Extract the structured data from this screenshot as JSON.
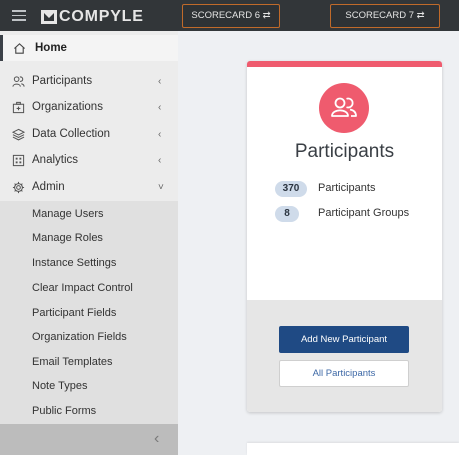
{
  "header": {
    "logo_text": "COMPYLE",
    "scorecard_buttons": [
      "SCORECARD 6 ⇄",
      "SCORECARD 7 ⇄"
    ]
  },
  "sidebar": {
    "items": [
      {
        "label": "Home",
        "icon": "home-icon"
      },
      {
        "label": "Participants",
        "icon": "participants-icon",
        "chevron": "‹"
      },
      {
        "label": "Organizations",
        "icon": "organization-icon",
        "chevron": "‹"
      },
      {
        "label": "Data Collection",
        "icon": "layers-icon",
        "chevron": "‹"
      },
      {
        "label": "Analytics",
        "icon": "analytics-icon",
        "chevron": "‹"
      },
      {
        "label": "Admin",
        "icon": "gear-icon",
        "chevron": "˅"
      }
    ],
    "admin_submenu": [
      "Manage Users",
      "Manage Roles",
      "Instance Settings",
      "Clear Impact Control",
      "Participant Fields",
      "Organization Fields",
      "Email Templates",
      "Note Types",
      "Public Forms"
    ],
    "collapse_chevron": "‹"
  },
  "card": {
    "accent_color": "#ef5b6e",
    "title": "Participants",
    "stats": [
      {
        "count": "370",
        "label": "Participants"
      },
      {
        "count": "8",
        "label": "Participant Groups"
      }
    ],
    "primary_button": "Add New Participant",
    "secondary_button": "All Participants"
  }
}
